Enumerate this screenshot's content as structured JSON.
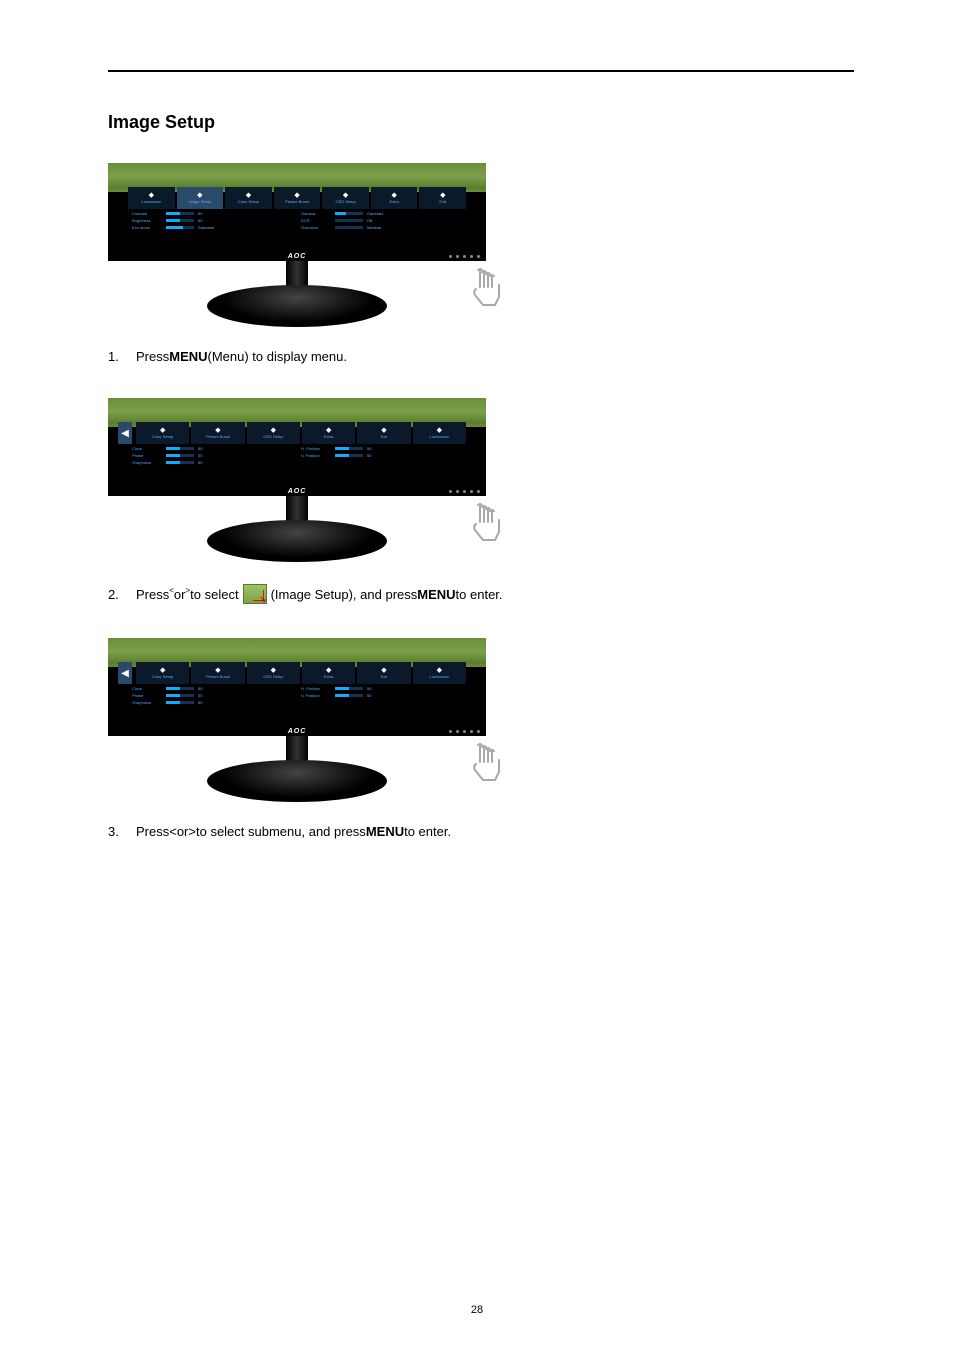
{
  "page": {
    "section_title": "Image Setup",
    "page_number": "28"
  },
  "brand": "AOC",
  "steps": {
    "s1": {
      "num": "1.",
      "pre": "Press ",
      "menu": "MENU",
      "post": " (Menu) to display menu."
    },
    "s2": {
      "num": "2.",
      "pre": "Press ",
      "lt": "<",
      "or": " or ",
      "gt": ">",
      "mid": "  to select ",
      "img_label": " (Image Setup), and press ",
      "menu": "MENU",
      "post": " to enter."
    },
    "s3": {
      "num": "3.",
      "pre": "Press ",
      "lt": "<",
      "or": " or  ",
      "gt": ">",
      "mid": "  to select submenu, and press ",
      "menu": "MENU",
      "post": " to enter."
    }
  },
  "osd_figure1": {
    "tabs": [
      "Luminance",
      "Image Setup",
      "Color Setup",
      "Picture Boost",
      "OSD Setup",
      "Extra",
      "Exit"
    ],
    "highlight_index": 1,
    "left_rows": [
      {
        "label": "Contrast",
        "fill": 50,
        "val": "50"
      },
      {
        "label": "Brightness",
        "fill": 50,
        "val": "50"
      },
      {
        "label": "Eco mode",
        "fill": 60,
        "val": "Standard"
      }
    ],
    "right_rows": [
      {
        "label": "Gamma",
        "fill": 40,
        "val": "Gamma1"
      },
      {
        "label": "DCR",
        "fill": 0,
        "val": "Off"
      },
      {
        "label": "Overdrive",
        "fill": 0,
        "val": "Medium"
      }
    ]
  },
  "osd_figure2": {
    "tabs": [
      "Color Setup",
      "Picture Boost",
      "OSD Setup",
      "Extra",
      "Exit",
      "Luminance"
    ],
    "highlight_index": 99,
    "arrow": true,
    "left_rows": [
      {
        "label": "Clock",
        "fill": 50,
        "val": "50"
      },
      {
        "label": "Phase",
        "fill": 50,
        "val": "50"
      },
      {
        "label": "Sharpness",
        "fill": 50,
        "val": "50"
      }
    ],
    "right_rows": [
      {
        "label": "H. Position",
        "fill": 50,
        "val": "50"
      },
      {
        "label": "V. Position",
        "fill": 50,
        "val": "50"
      }
    ]
  },
  "osd_figure3": {
    "tabs": [
      "Color Setup",
      "Picture Boost",
      "OSD Setup",
      "Extra",
      "Exit",
      "Luminance"
    ],
    "highlight_index": 99,
    "arrow": true,
    "left_rows": [
      {
        "label": "Clock",
        "fill": 50,
        "val": "50"
      },
      {
        "label": "Phase",
        "fill": 50,
        "val": "50"
      },
      {
        "label": "Sharpness",
        "fill": 50,
        "val": "50"
      }
    ],
    "right_rows": [
      {
        "label": "H. Position",
        "fill": 50,
        "val": "50"
      },
      {
        "label": "V. Position",
        "fill": 50,
        "val": "50"
      }
    ]
  }
}
